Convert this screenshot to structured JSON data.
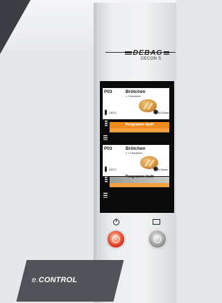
{
  "brand": {
    "name": "DEBAG",
    "model": "DECON S"
  },
  "programs": [
    {
      "program": "P03",
      "name": "Brötchen",
      "stage": "1. 3 Backstufe",
      "temperature": "230°C",
      "time": "00:52",
      "time_unit": "min",
      "status": "Programm läuft"
    },
    {
      "program": "P03",
      "name": "Brötchen",
      "stage": "3. 12 Backstufe",
      "temperature": "230°C",
      "time": "0:34",
      "time_unit": "min",
      "status": "Programm läuft"
    }
  ],
  "buttons": {
    "power": {
      "icon": "power-icon",
      "color": "#e03a2a"
    },
    "display": {
      "icon": "display-icon",
      "color": "#8a8a8a"
    }
  },
  "footer": {
    "prefix": "e.",
    "label": "CONTROL"
  },
  "colors": {
    "status": "#f08a1c",
    "panel": "#eceef0",
    "label_bg": "#505459"
  }
}
